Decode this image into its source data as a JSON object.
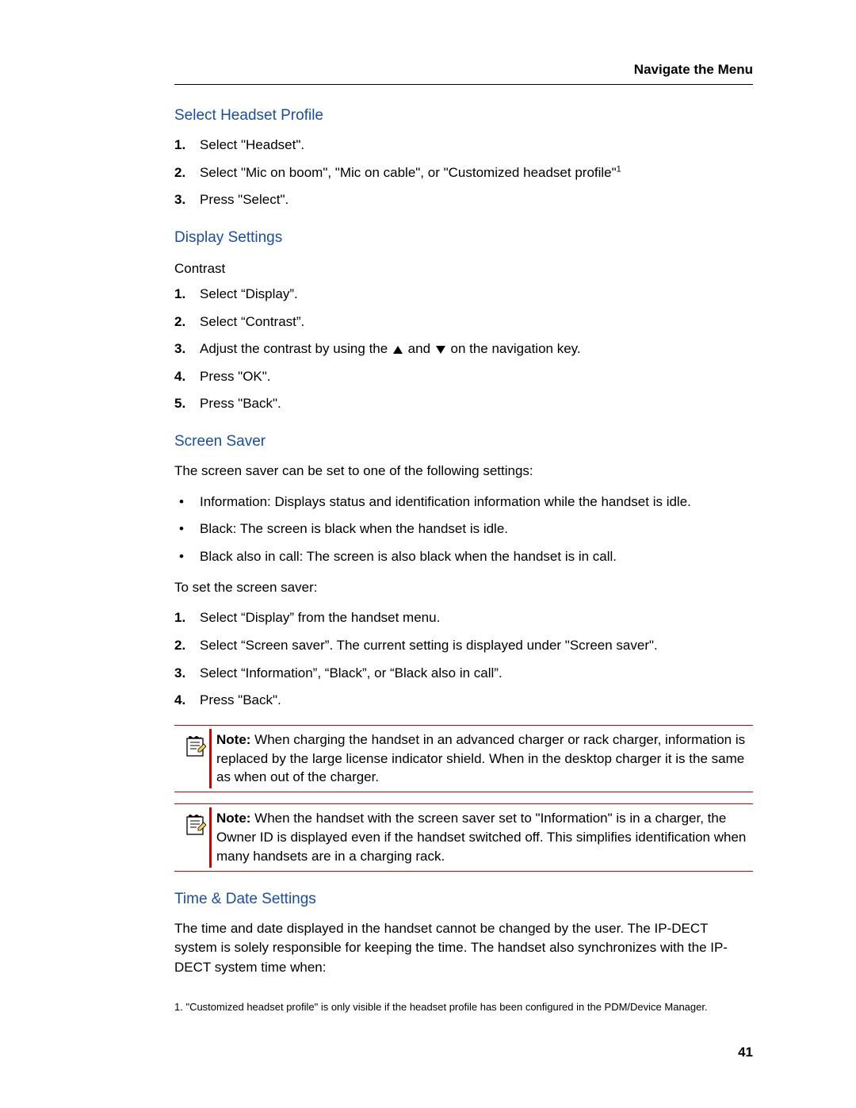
{
  "header": {
    "title": "Navigate the Menu"
  },
  "sections": {
    "headset": {
      "heading": "Select Headset Profile",
      "steps": [
        "Select \"Headset\".",
        "Select \"Mic on boom\",  \"Mic on cable\", or  \"Customized headset profile\"",
        "Press \"Select\"."
      ],
      "footref": "1"
    },
    "display": {
      "heading": "Display Settings",
      "sub": "Contrast",
      "step1": "Select “Display”.",
      "step2": "Select “Contrast”.",
      "step3a": "Adjust the contrast by using the ",
      "step3b": " and ",
      "step3c": " on the navigation key.",
      "step4": "Press \"OK\".",
      "step5": "Press \"Back\"."
    },
    "screensaver": {
      "heading": "Screen Saver",
      "intro": "The screen saver can be set to one of the following settings:",
      "bullets": [
        "Information: Displays status and identification information while the handset is idle.",
        "Black: The screen is black when the handset is idle.",
        "Black also in call: The screen is also black when the handset is in call."
      ],
      "toset": "To set the screen saver:",
      "steps": [
        "Select “Display” from the handset menu.",
        "Select “Screen saver”. The current setting is displayed under \"Screen saver\".",
        "Select “Information”, “Black”, or “Black also in call”.",
        "Press \"Back\"."
      ],
      "note1_label": "Note: ",
      "note1": "When charging the handset in an advanced charger or rack charger, information is replaced by the large license indicator shield. When in the desktop charger it is the same as when out of the charger.",
      "note2_label": "Note: ",
      "note2": "When the handset with the screen saver set to \"Information\" is in a charger, the Owner ID is displayed even if the handset switched off. This simplifies identification when many handsets are in a charging rack."
    },
    "timedate": {
      "heading": "Time & Date Settings",
      "body": "The time and date displayed in the handset cannot be changed by the user. The IP-DECT system is solely responsible for keeping the time. The handset also synchronizes with the IP-DECT system time when:"
    }
  },
  "footnote": "1. \"Customized headset profile\" is only visible if the headset profile has been configured in the PDM/Device Manager.",
  "page_number": "41"
}
